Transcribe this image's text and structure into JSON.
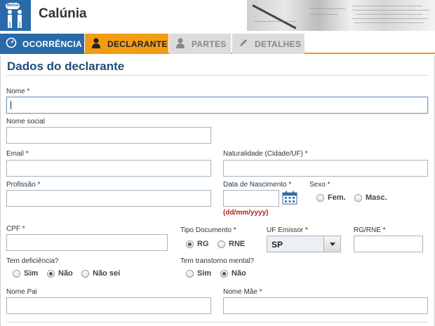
{
  "app": {
    "title": "Calúnia",
    "logo_bubble": "Bolsa"
  },
  "tabs": [
    {
      "label": "OCORRÊNCIA"
    },
    {
      "label": "DECLARANTE"
    },
    {
      "label": "PARTES"
    },
    {
      "label": "DETALHES"
    }
  ],
  "section": {
    "title": "Dados do declarante"
  },
  "form": {
    "nome": {
      "label": "Nome *",
      "value": ""
    },
    "nome_social": {
      "label": "Nome social",
      "value": ""
    },
    "email": {
      "label": "Email *",
      "value": ""
    },
    "naturalidade": {
      "label": "Naturalidade (Cidade/UF) *",
      "value": ""
    },
    "profissao": {
      "label": "Profissão *",
      "value": ""
    },
    "data_nascimento": {
      "label": "Data de Nascimento *",
      "value": "",
      "hint": "(dd/mm/yyyy)"
    },
    "sexo": {
      "label": "Sexo *",
      "options": [
        "Fem.",
        "Masc."
      ],
      "selected": null
    },
    "cpf": {
      "label": "CPF *",
      "value": ""
    },
    "tipo_documento": {
      "label": "Tipo Documento *",
      "options": [
        "RG",
        "RNE"
      ],
      "selected": "RG"
    },
    "uf_emissor": {
      "label": "UF Emissor *",
      "value": "SP"
    },
    "rg_rne": {
      "label": "RG/RNE *",
      "value": ""
    },
    "deficiencia": {
      "label": "Tem deficiência?",
      "options": [
        "Sim",
        "Não",
        "Não sei"
      ],
      "selected": "Não"
    },
    "transtorno": {
      "label": "Tem transtorno mental?",
      "options": [
        "Sim",
        "Não"
      ],
      "selected": "Não"
    },
    "nome_pai": {
      "label": "Nome Pai",
      "value": ""
    },
    "nome_mae": {
      "label": "Nome Mãe *",
      "value": ""
    }
  },
  "colors": {
    "primary": "#2a6aa8",
    "accent": "#f39c12",
    "title": "#1f4e79",
    "hint": "#b22222"
  }
}
